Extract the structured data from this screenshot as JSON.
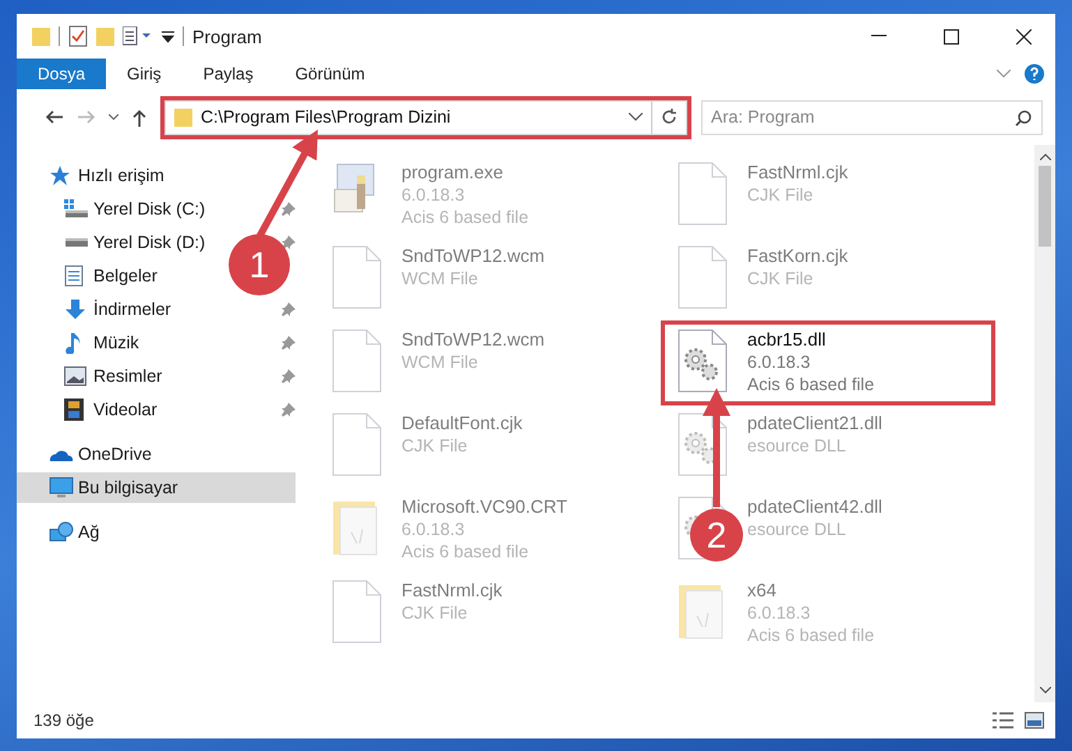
{
  "window": {
    "title": "Program"
  },
  "ribbon_tabs": [
    {
      "label": "Dosya",
      "selected": true
    },
    {
      "label": "Giriş",
      "selected": false
    },
    {
      "label": "Paylaş",
      "selected": false
    },
    {
      "label": "Görünüm",
      "selected": false
    }
  ],
  "address": {
    "path": "C:\\Program Files\\Program Dizini",
    "highlighted": true
  },
  "search": {
    "placeholder": "Ara: Program"
  },
  "sidebar": {
    "items": [
      {
        "label": "Hızlı erişim",
        "kind": "star",
        "indent": false,
        "pinned": false,
        "selected": false
      },
      {
        "label": "Yerel Disk (C:)",
        "kind": "drive-c",
        "indent": true,
        "pinned": true,
        "selected": false
      },
      {
        "label": "Yerel Disk (D:)",
        "kind": "drive",
        "indent": true,
        "pinned": true,
        "selected": false
      },
      {
        "label": "Belgeler",
        "kind": "docs",
        "indent": true,
        "pinned": false,
        "selected": false
      },
      {
        "label": "İndirmeler",
        "kind": "download",
        "indent": true,
        "pinned": true,
        "selected": false
      },
      {
        "label": "Müzik",
        "kind": "music",
        "indent": true,
        "pinned": true,
        "selected": false
      },
      {
        "label": "Resimler",
        "kind": "pictures",
        "indent": true,
        "pinned": true,
        "selected": false
      },
      {
        "label": "Videolar",
        "kind": "videos",
        "indent": true,
        "pinned": true,
        "selected": false
      },
      {
        "label": "OneDrive",
        "kind": "cloud",
        "indent": false,
        "pinned": false,
        "selected": false
      },
      {
        "label": "Bu bilgisayar",
        "kind": "pc",
        "indent": false,
        "pinned": false,
        "selected": true
      },
      {
        "label": "Ağ",
        "kind": "network",
        "indent": false,
        "pinned": false,
        "selected": false
      }
    ]
  },
  "files": [
    {
      "kind": "exe",
      "name": "program.exe",
      "lines": [
        "6.0.18.3",
        "Acis 6 based file"
      ],
      "highlighted": false
    },
    {
      "kind": "file",
      "name": "FastNrml.cjk",
      "lines": [
        "CJK File"
      ],
      "highlighted": false
    },
    {
      "kind": "file",
      "name": "SndToWP12.wcm",
      "lines": [
        "WCM File"
      ],
      "highlighted": false
    },
    {
      "kind": "file",
      "name": "FastKorn.cjk",
      "lines": [
        "CJK File"
      ],
      "highlighted": false
    },
    {
      "kind": "file",
      "name": "SndToWP12.wcm",
      "lines": [
        "WCM File"
      ],
      "highlighted": false
    },
    {
      "kind": "dll",
      "name": "acbr15.dll",
      "lines": [
        "6.0.18.3",
        "Acis 6 based file"
      ],
      "highlighted": true
    },
    {
      "kind": "file",
      "name": "DefaultFont.cjk",
      "lines": [
        "CJK File"
      ],
      "highlighted": false
    },
    {
      "kind": "dll",
      "name": "pdateClient21.dll",
      "lines": [
        "esource DLL"
      ],
      "highlighted": false
    },
    {
      "kind": "folder",
      "name": "Microsoft.VC90.CRT",
      "lines": [
        "6.0.18.3",
        "Acis 6 based file"
      ],
      "highlighted": false
    },
    {
      "kind": "dll",
      "name": "pdateClient42.dll",
      "lines": [
        "esource DLL"
      ],
      "highlighted": false
    },
    {
      "kind": "file",
      "name": "FastNrml.cjk",
      "lines": [
        "CJK File"
      ],
      "highlighted": false
    },
    {
      "kind": "folder",
      "name": "x64",
      "lines": [
        "6.0.18.3",
        "Acis 6 based file"
      ],
      "highlighted": false
    }
  ],
  "status_bar": {
    "count": "139 öğe"
  },
  "annotations": [
    {
      "label": "1"
    },
    {
      "label": "2"
    }
  ]
}
